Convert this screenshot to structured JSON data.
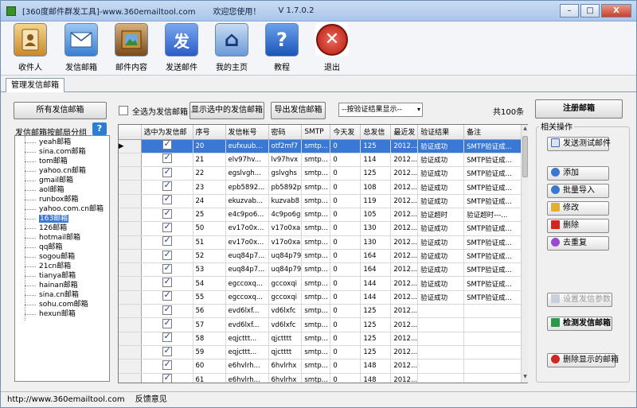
{
  "window": {
    "title": "[360度邮件群发工具]-www.360emailtool.com",
    "welcome": "欢迎您使用！",
    "version": "V 1.7.0.2",
    "min_label": "–",
    "max_label": "□",
    "close_label": "X"
  },
  "toolbar": {
    "items": [
      {
        "label": "收件人",
        "icon": "contacts-book-icon",
        "color": "#d8a13a"
      },
      {
        "label": "发信邮箱",
        "icon": "envelope-icon",
        "color": "#4a8fd8"
      },
      {
        "label": "邮件内容",
        "icon": "picture-frame-icon",
        "color": "#8a5a2a"
      },
      {
        "label": "发送邮件",
        "icon": "send-text-icon",
        "glyph": "发",
        "color": "#3b6fd0"
      },
      {
        "label": "我的主页",
        "icon": "home-icon",
        "glyph": "⌂",
        "color": "#3b7fd8"
      },
      {
        "label": "教程",
        "icon": "help-icon",
        "glyph": "?",
        "color": "#2a6cc8"
      },
      {
        "label": "退出",
        "icon": "exit-icon",
        "glyph": "✕",
        "color": "#d0281e"
      }
    ]
  },
  "tabs": {
    "active": "管理发信邮箱"
  },
  "left": {
    "all_button": "所有发信邮箱",
    "group_label": "发信邮箱按邮局分组",
    "help_glyph": "?",
    "tree": [
      "yeah邮箱",
      "sina.com邮箱",
      "tom邮箱",
      "yahoo.cn邮箱",
      "gmail邮箱",
      "aol邮箱",
      "runbox邮箱",
      "yahoo.com.cn邮箱",
      "163邮箱",
      "126邮箱",
      "hotmail邮箱",
      "qq邮箱",
      "sogou邮箱",
      "21cn邮箱",
      "tianya邮箱",
      "hainan邮箱",
      "sina.cn邮箱",
      "sohu.com邮箱",
      "hexun邮箱"
    ],
    "selected_index": 8
  },
  "top": {
    "select_all_label": "全选为发信邮箱",
    "show_selected_button": "显示选中的发信邮箱",
    "export_button": "导出发信邮箱",
    "filter_value": "--按验证结果显示--",
    "filter_arrow": "▾",
    "total": "共100条",
    "register_button": "注册邮箱"
  },
  "grid": {
    "columns": [
      "选中为发信邮",
      "序号",
      "发信帐号",
      "密码",
      "SMTP",
      "今天发",
      "总发信",
      "最近发",
      "验证结果",
      "备注"
    ],
    "rows": [
      {
        "checked": true,
        "id": "20",
        "account": "eufxuub...",
        "pwd": "otf2mf7",
        "smtp": "smtp...",
        "today": "0",
        "total": "125",
        "recent": "2012...",
        "result": "验证成功",
        "note": "SMTP验证成...",
        "selected": true
      },
      {
        "checked": true,
        "id": "21",
        "account": "elv97hv...",
        "pwd": "lv97hvx",
        "smtp": "smtp...",
        "today": "0",
        "total": "114",
        "recent": "2012...",
        "result": "验证成功",
        "note": "SMTP验证成..."
      },
      {
        "checked": true,
        "id": "22",
        "account": "egslvgh...",
        "pwd": "gslvghs",
        "smtp": "smtp...",
        "today": "0",
        "total": "125",
        "recent": "2012...",
        "result": "验证成功",
        "note": "SMTP验证成..."
      },
      {
        "checked": true,
        "id": "23",
        "account": "epb5892...",
        "pwd": "pb5892p",
        "smtp": "smtp...",
        "today": "0",
        "total": "108",
        "recent": "2012...",
        "result": "验证成功",
        "note": "SMTP验证成..."
      },
      {
        "checked": true,
        "id": "24",
        "account": "ekuzvab...",
        "pwd": "kuzvab8",
        "smtp": "smtp...",
        "today": "0",
        "total": "119",
        "recent": "2012...",
        "result": "验证成功",
        "note": "SMTP验证成..."
      },
      {
        "checked": true,
        "id": "25",
        "account": "e4c9po6...",
        "pwd": "4c9po6g",
        "smtp": "smtp...",
        "today": "0",
        "total": "105",
        "recent": "2012...",
        "result": "验证超时",
        "note": "验证超时---..."
      },
      {
        "checked": true,
        "id": "50",
        "account": "ev17o0x...",
        "pwd": "v17o0xa",
        "smtp": "smtp...",
        "today": "0",
        "total": "130",
        "recent": "2012...",
        "result": "验证成功",
        "note": "SMTP验证成..."
      },
      {
        "checked": true,
        "id": "51",
        "account": "ev17o0x...",
        "pwd": "v17o0xa",
        "smtp": "smtp...",
        "today": "0",
        "total": "130",
        "recent": "2012...",
        "result": "验证成功",
        "note": "SMTP验证成..."
      },
      {
        "checked": true,
        "id": "52",
        "account": "euq84p7...",
        "pwd": "uq84p79",
        "smtp": "smtp...",
        "today": "0",
        "total": "164",
        "recent": "2012...",
        "result": "验证成功",
        "note": "SMTP验证成..."
      },
      {
        "checked": true,
        "id": "53",
        "account": "euq84p7...",
        "pwd": "uq84p79",
        "smtp": "smtp...",
        "today": "0",
        "total": "164",
        "recent": "2012...",
        "result": "验证成功",
        "note": "SMTP验证成..."
      },
      {
        "checked": true,
        "id": "54",
        "account": "egccoxq...",
        "pwd": "gccoxqi",
        "smtp": "smtp...",
        "today": "0",
        "total": "144",
        "recent": "2012...",
        "result": "验证成功",
        "note": "SMTP验证成..."
      },
      {
        "checked": true,
        "id": "55",
        "account": "egccoxq...",
        "pwd": "gccoxqi",
        "smtp": "smtp...",
        "today": "0",
        "total": "144",
        "recent": "2012...",
        "result": "验证成功",
        "note": "SMTP验证成..."
      },
      {
        "checked": true,
        "id": "56",
        "account": "evd6lxf...",
        "pwd": "vd6lxfc",
        "smtp": "smtp...",
        "today": "0",
        "total": "125",
        "recent": "2012...",
        "result": "",
        "note": ""
      },
      {
        "checked": true,
        "id": "57",
        "account": "evd6lxf...",
        "pwd": "vd6lxfc",
        "smtp": "smtp...",
        "today": "0",
        "total": "125",
        "recent": "2012...",
        "result": "",
        "note": ""
      },
      {
        "checked": true,
        "id": "58",
        "account": "eqjcttt...",
        "pwd": "qjctttt",
        "smtp": "smtp...",
        "today": "0",
        "total": "125",
        "recent": "2012...",
        "result": "",
        "note": ""
      },
      {
        "checked": true,
        "id": "59",
        "account": "eqjcttt...",
        "pwd": "qjctttt",
        "smtp": "smtp...",
        "today": "0",
        "total": "125",
        "recent": "2012...",
        "result": "",
        "note": ""
      },
      {
        "checked": true,
        "id": "60",
        "account": "e6hvlrh...",
        "pwd": "6hvlrhx",
        "smtp": "smtp...",
        "today": "0",
        "total": "148",
        "recent": "2012...",
        "result": "",
        "note": ""
      },
      {
        "checked": true,
        "id": "61",
        "account": "e6hvlrh...",
        "pwd": "6hvlrhx",
        "smtp": "smtp...",
        "today": "0",
        "total": "148",
        "recent": "2012...",
        "result": "",
        "note": ""
      }
    ],
    "row_marker": "▶"
  },
  "actions": {
    "title": "相关操作",
    "send_test": "发送测试邮件",
    "add": "添加",
    "batch_import": "批量导入",
    "edit": "修改",
    "delete": "删除",
    "dedupe": "去重复",
    "settings": "设置发信参数",
    "check": "检测发信邮箱",
    "delete_shown": "删除显示的邮箱"
  },
  "status": {
    "url": "http://www.360emailtool.com",
    "feedback": "反馈意见"
  }
}
